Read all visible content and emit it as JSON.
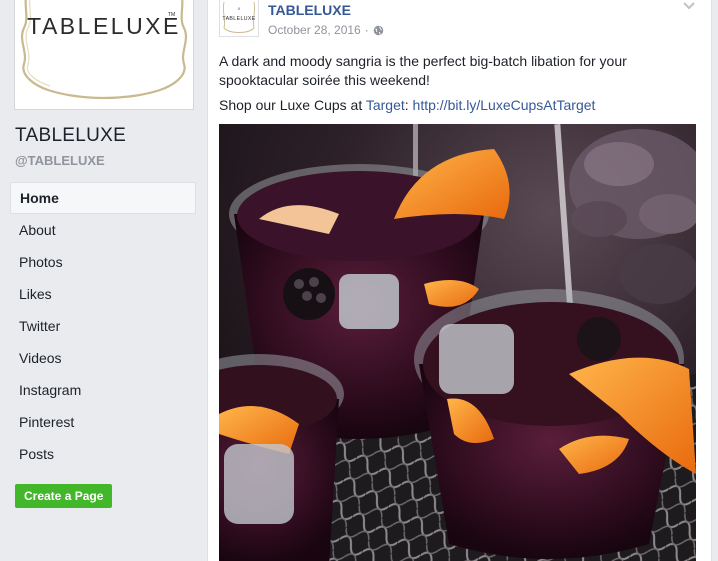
{
  "page": {
    "logo_text": "TABLELUXE",
    "name": "TABLELUXE",
    "handle": "@TABLELUXE"
  },
  "nav": {
    "items": [
      {
        "label": "Home",
        "active": true
      },
      {
        "label": "About"
      },
      {
        "label": "Photos"
      },
      {
        "label": "Likes"
      },
      {
        "label": "Twitter"
      },
      {
        "label": "Videos"
      },
      {
        "label": "Instagram"
      },
      {
        "label": "Pinterest"
      },
      {
        "label": "Posts"
      }
    ],
    "create_page_label": "Create a Page"
  },
  "post": {
    "author": "TABLELUXE",
    "date": "October 28, 2016",
    "separator": "·",
    "privacy_icon": "globe-icon",
    "menu_icon": "chevron-down-icon",
    "text_line1": "A dark and moody sangria is the perfect big-batch libation for your spooktacular soirée this weekend!",
    "text_line2_prefix": "Shop our Luxe Cups at ",
    "text_line2_link1": "Target",
    "text_line2_colon": ": ",
    "text_line2_link2": "http://bit.ly/LuxeCupsAtTarget"
  },
  "colors": {
    "link": "#365899",
    "create_button": "#42b72a",
    "background": "#e9ebee"
  }
}
